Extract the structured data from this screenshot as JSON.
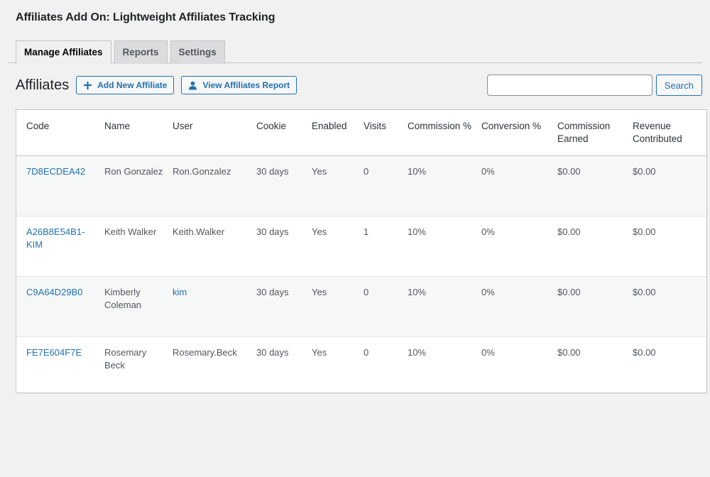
{
  "header": {
    "title": "Affiliates Add On: Lightweight Affiliates Tracking"
  },
  "tabs": [
    {
      "label": "Manage Affiliates",
      "active": true
    },
    {
      "label": "Reports",
      "active": false
    },
    {
      "label": "Settings",
      "active": false
    }
  ],
  "toolbar": {
    "heading": "Affiliates",
    "add_new_label": "Add New Affiliate",
    "add_new_icon": "plus-icon",
    "view_report_label": "View Affiliates Report",
    "view_report_icon": "user-icon"
  },
  "search": {
    "value": "",
    "placeholder": "",
    "submit_label": "Search"
  },
  "table": {
    "columns": [
      "Code",
      "Name",
      "User",
      "Cookie",
      "Enabled",
      "Visits",
      "Commission %",
      "Conversion %",
      "Commission Earned",
      "Revenue Contributed"
    ],
    "rows": [
      {
        "code": "7D8ECDEA42",
        "code_is_link": true,
        "name": "Ron Gonzalez",
        "user": "Ron.Gonzalez",
        "user_is_link": false,
        "cookie": "30 days",
        "enabled": "Yes",
        "visits": "0",
        "commission_pct": "10%",
        "conversion_pct": "0%",
        "commission_earned": "$0.00",
        "revenue_contributed": "$0.00"
      },
      {
        "code": "A26B8E54B1-KIM",
        "code_is_link": true,
        "name": "Keith Walker",
        "user": "Keith.Walker",
        "user_is_link": false,
        "cookie": "30 days",
        "enabled": "Yes",
        "visits": "1",
        "commission_pct": "10%",
        "conversion_pct": "0%",
        "commission_earned": "$0.00",
        "revenue_contributed": "$0.00"
      },
      {
        "code": "C9A64D29B0",
        "code_is_link": true,
        "name": "Kimberly Coleman",
        "user": "kim",
        "user_is_link": true,
        "cookie": "30 days",
        "enabled": "Yes",
        "visits": "0",
        "commission_pct": "10%",
        "conversion_pct": "0%",
        "commission_earned": "$0.00",
        "revenue_contributed": "$0.00"
      },
      {
        "code": "FE7E604F7E",
        "code_is_link": true,
        "name": "Rosemary Beck",
        "user": "Rosemary.Beck",
        "user_is_link": false,
        "cookie": "30 days",
        "enabled": "Yes",
        "visits": "0",
        "commission_pct": "10%",
        "conversion_pct": "0%",
        "commission_earned": "$0.00",
        "revenue_contributed": "$0.00"
      }
    ]
  },
  "colors": {
    "page_background": "#f1f1f1",
    "link": "#2271b1",
    "text": "#50575e",
    "heading": "#1d2327",
    "border": "#c3c4c7",
    "alt_row": "#f6f7f7"
  }
}
